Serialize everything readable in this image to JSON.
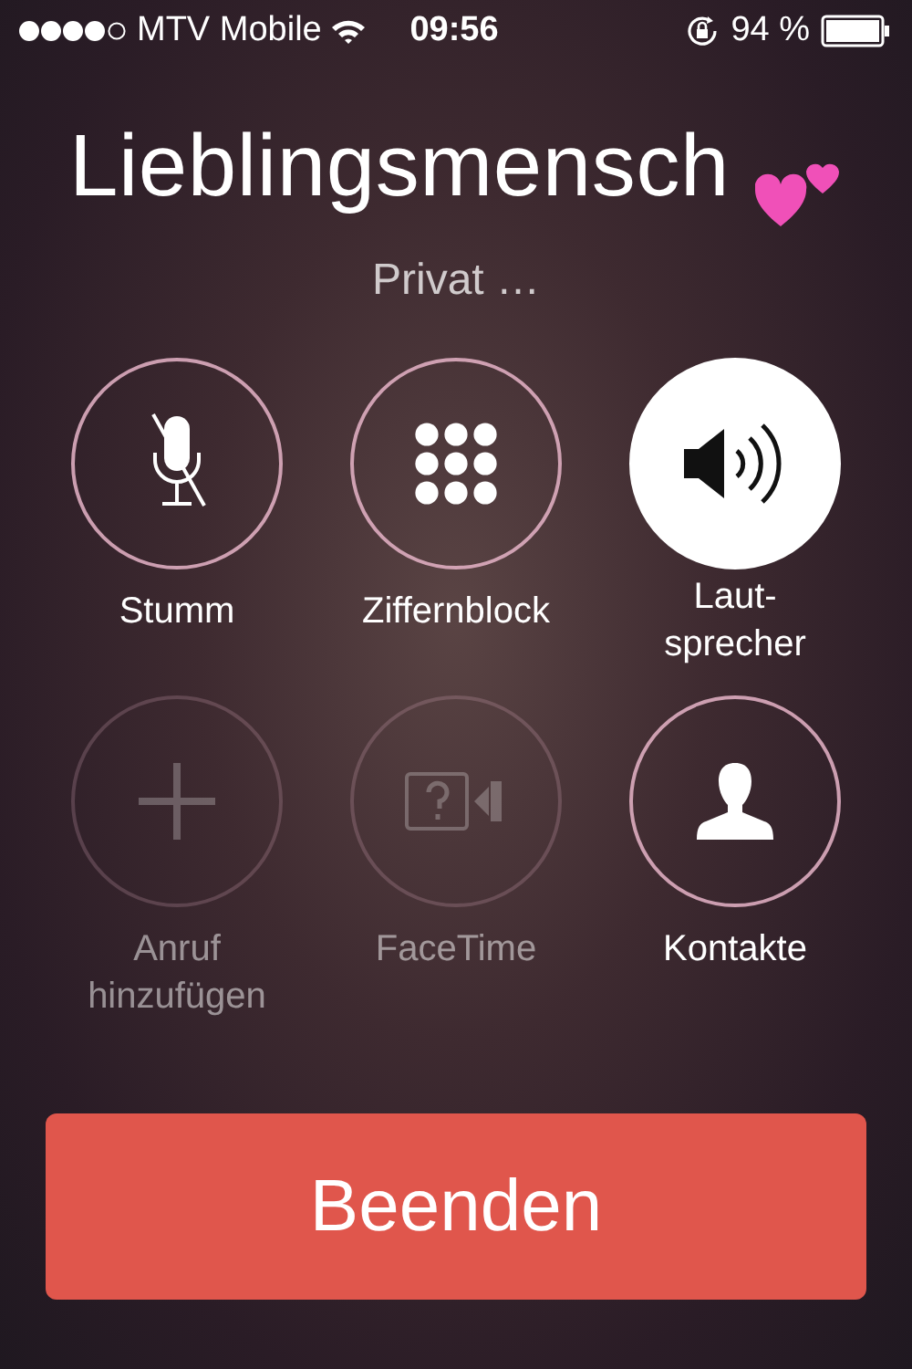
{
  "status_bar": {
    "carrier": "MTV Mobile",
    "time": "09:56",
    "battery_percent": "94 %"
  },
  "caller": {
    "name": "Lieblingsmensch",
    "status": "Privat …"
  },
  "controls": [
    {
      "kind": "mute",
      "label": "Stumm",
      "selected": false,
      "disabled": false
    },
    {
      "kind": "keypad",
      "label": "Ziffernblock",
      "selected": false,
      "disabled": false
    },
    {
      "kind": "speaker",
      "label": "Laut-\nsprecher",
      "selected": true,
      "disabled": false
    },
    {
      "kind": "add",
      "label": "Anruf\nhinzufügen",
      "selected": false,
      "disabled": true
    },
    {
      "kind": "facetime",
      "label": "FaceTime",
      "selected": false,
      "disabled": true
    },
    {
      "kind": "contacts",
      "label": "Kontakte",
      "selected": false,
      "disabled": false
    }
  ],
  "end_button": {
    "label": "Beenden"
  }
}
